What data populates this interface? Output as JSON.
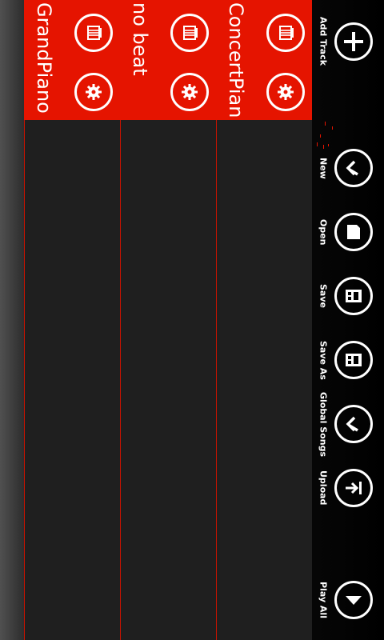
{
  "tracks": [
    {
      "name": "ConcertPiano",
      "delete_icon": "delete-icon",
      "settings_icon": "gear-icon"
    },
    {
      "name": "no beat",
      "delete_icon": "delete-icon",
      "settings_icon": "gear-icon"
    },
    {
      "name": "GrandPiano",
      "delete_icon": "delete-icon",
      "settings_icon": "gear-icon"
    }
  ],
  "appbar": {
    "add_track": {
      "label": "Add Track",
      "icon": "plus-icon"
    },
    "new": {
      "label": "New",
      "icon": "back-arrow-icon"
    },
    "open": {
      "label": "Open",
      "icon": "file-icon"
    },
    "save": {
      "label": "Save",
      "icon": "floppy-icon"
    },
    "save_as": {
      "label": "Save As",
      "icon": "floppy-icon"
    },
    "global_songs": {
      "label": "Global Songs",
      "icon": "back-arrow-icon"
    },
    "upload": {
      "label": "Upload",
      "icon": "upload-arrow-icon"
    },
    "play_all": {
      "label": "Play All",
      "icon": "down-triangle-icon"
    }
  },
  "colors": {
    "accent": "#e51400",
    "track_bg": "#1f1f1f",
    "foreground": "#ffffff"
  }
}
